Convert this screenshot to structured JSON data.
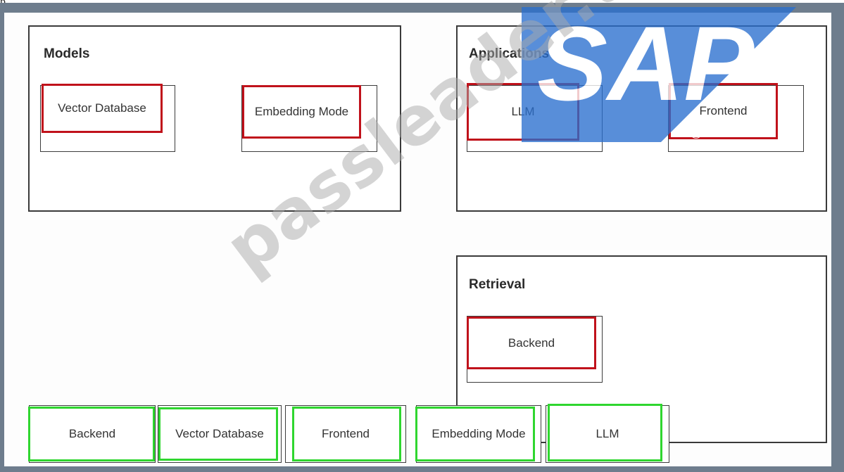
{
  "header_fragment": "p",
  "models": {
    "title": "Models",
    "slots": [
      "Vector Database",
      "Embedding Mode"
    ]
  },
  "applications": {
    "title": "Applications",
    "slots": [
      "LLM",
      "Frontend"
    ]
  },
  "retrieval": {
    "title": "Retrieval",
    "slots": [
      "Backend"
    ]
  },
  "options": [
    "Backend",
    "Vector Database",
    "Frontend",
    "Embedding Mode",
    "LLM"
  ],
  "watermark": "passleader.top",
  "logo": {
    "text": "SAP",
    "registered": "®",
    "color": "#2a6fcf"
  },
  "colors": {
    "placed_outline": "#c0121b",
    "option_outline": "#2fd62f",
    "frame": "#6e7d8d"
  }
}
